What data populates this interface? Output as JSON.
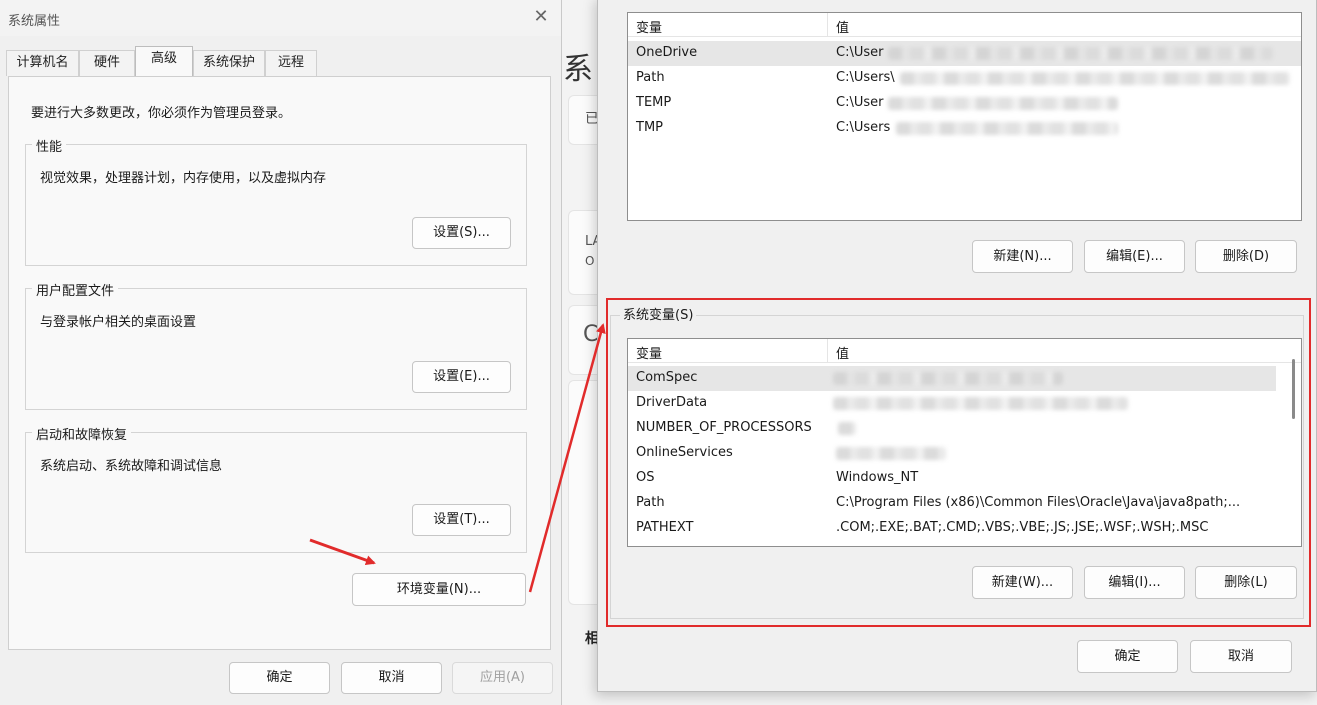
{
  "background": {
    "title": "系",
    "snippets": [
      "已",
      "LA",
      "O",
      "C",
      "相"
    ]
  },
  "system_properties": {
    "title": "系统属性",
    "tabs": [
      "计算机名",
      "硬件",
      "高级",
      "系统保护",
      "远程"
    ],
    "active_tab": "高级",
    "notice": "要进行大多数更改，你必须作为管理员登录。",
    "groups": {
      "performance": {
        "label": "性能",
        "desc": "视觉效果，处理器计划，内存使用，以及虚拟内存",
        "button": "设置(S)..."
      },
      "user_profiles": {
        "label": "用户配置文件",
        "desc": "与登录帐户相关的桌面设置",
        "button": "设置(E)..."
      },
      "startup": {
        "label": "启动和故障恢复",
        "desc": "系统启动、系统故障和调试信息",
        "button": "设置(T)..."
      }
    },
    "env_button": "环境变量(N)...",
    "footer": {
      "ok": "确定",
      "cancel": "取消",
      "apply": "应用(A)"
    }
  },
  "environment_variables": {
    "user_vars": {
      "headers": {
        "name": "变量",
        "value": "值"
      },
      "rows": [
        {
          "name": "OneDrive",
          "value": "C:\\User"
        },
        {
          "name": "Path",
          "value": "C:\\Users\\"
        },
        {
          "name": "TEMP",
          "value": "C:\\User"
        },
        {
          "name": "TMP",
          "value": "C:\\Users"
        }
      ],
      "buttons": {
        "new": "新建(N)...",
        "edit": "编辑(E)...",
        "delete": "删除(D)"
      }
    },
    "system_vars": {
      "group_label": "系统变量(S)",
      "headers": {
        "name": "变量",
        "value": "值"
      },
      "rows": [
        {
          "name": "ComSpec",
          "value": ""
        },
        {
          "name": "DriverData",
          "value": ""
        },
        {
          "name": "NUMBER_OF_PROCESSORS",
          "value": ""
        },
        {
          "name": "OnlineServices",
          "value": ""
        },
        {
          "name": "OS",
          "value": "Windows_NT"
        },
        {
          "name": "Path",
          "value": "C:\\Program Files (x86)\\Common Files\\Oracle\\Java\\java8path;..."
        },
        {
          "name": "PATHEXT",
          "value": ".COM;.EXE;.BAT;.CMD;.VBS;.VBE;.JS;.JSE;.WSF;.WSH;.MSC"
        }
      ],
      "buttons": {
        "new": "新建(W)...",
        "edit": "编辑(I)...",
        "delete": "删除(L)"
      }
    },
    "footer": {
      "ok": "确定",
      "cancel": "取消"
    }
  },
  "annotation_color": "#e12b2b"
}
